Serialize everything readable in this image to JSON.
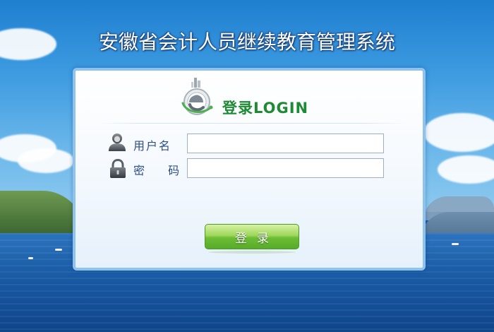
{
  "page": {
    "title": "安徽省会计人员继续教育管理系统"
  },
  "login_panel": {
    "heading": "登录LOGIN",
    "username_label": "用户名",
    "username_value": "",
    "password_label": "密 码",
    "password_value": "",
    "submit_label": "登录"
  },
  "icons": {
    "logo": "e-logo-icon",
    "user": "user-icon",
    "lock": "lock-icon"
  },
  "colors": {
    "heading_green": "#1f8a34",
    "label_blue": "#2d4f86",
    "button_green": "#6dbd35",
    "panel_border": "#8fc3ef",
    "sky_blue": "#3d9be0"
  }
}
